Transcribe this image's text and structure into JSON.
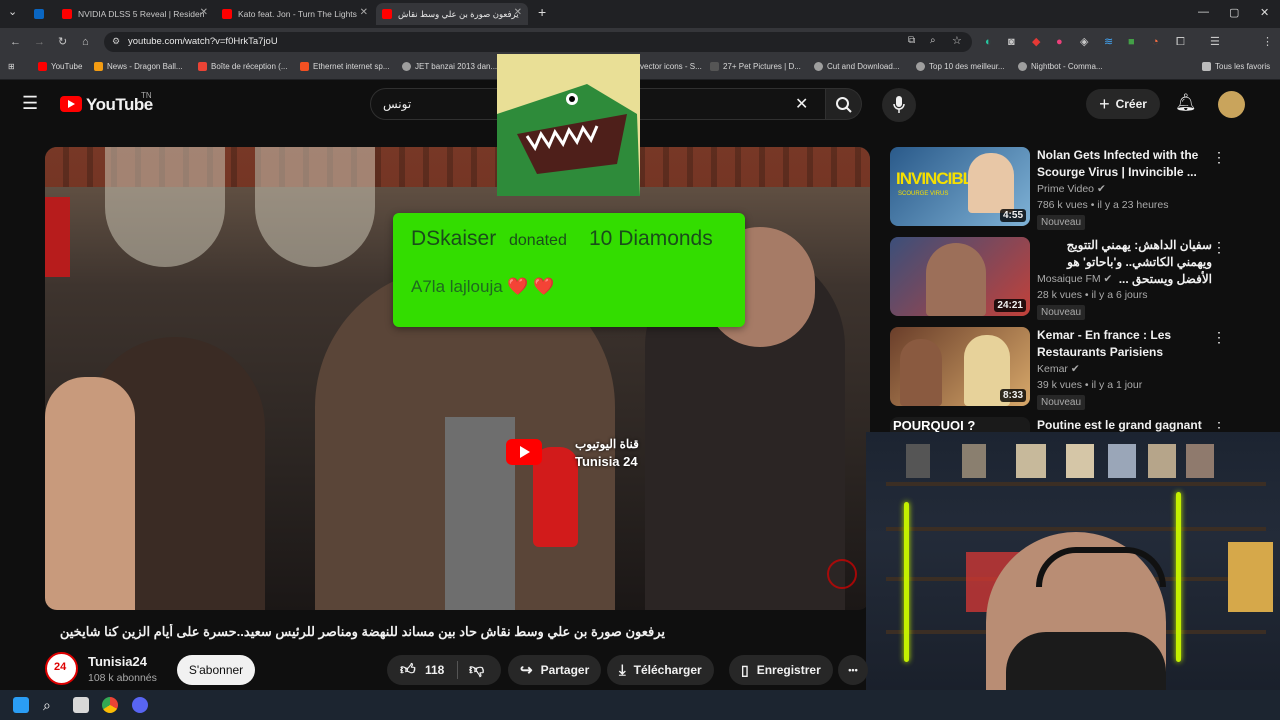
{
  "browser": {
    "tabs": [
      {
        "label": "",
        "icon": "linkedin-icon"
      },
      {
        "label": "NVIDIA DLSS 5 Reveal | Residen",
        "icon": "youtube-icon"
      },
      {
        "label": "Kato feat. Jon - Turn The Lights",
        "icon": "youtube-icon"
      },
      {
        "label": "يرفعون صورة بن علي وسط نقاش",
        "icon": "youtube-icon"
      }
    ],
    "new_tab": "+",
    "window_controls": [
      "—",
      "▢",
      "✕"
    ],
    "url": "youtube.com/watch?v=f0HrkTa7joU"
  },
  "bookmarks": [
    "YouTube",
    "News - Dragon Ball...",
    "Boîte de réception (...",
    "Ethernet internet sp...",
    "JET banzai 2013 dan...",
    "vector icons - S...",
    "27+ Pet Pictures | D...",
    "Cut and Download...",
    "Top 10 des meilleur...",
    "Nightbot - Comma..."
  ],
  "bookmarks_all": "Tous les favoris",
  "youtube": {
    "logo_text": "YouTube",
    "logo_region": "TN",
    "search_value": "تونس",
    "create_label": "Créer"
  },
  "overlay": {
    "donor": "DSkaiser",
    "donated_text": "donated",
    "amount": "10 Diamonds",
    "message": "A7la lajlouja ❤️ ❤️"
  },
  "watermark": {
    "arabic": "قناة اليوتيوب",
    "channel": "Tunisia 24"
  },
  "video": {
    "title": "يرفعون صورة بن علي وسط نقاش حاد بين مساند للنهضة ومناصر للرئيس سعيد..حسرة على أيام الزين كنا شايخين",
    "channel_name": "Tunisia24",
    "subscribers": "108 k abonnés",
    "subscribe_label": "S'abonner",
    "likes": "118",
    "share_label": "Partager",
    "download_label": "Télécharger",
    "save_label": "Enregistrer",
    "more_label": "•••"
  },
  "recommendations": [
    {
      "title": "Nolan Gets Infected with the Scourge Virus | Invincible ...",
      "channel": "Prime Video",
      "meta": "786 k vues • il y a 23 heures",
      "badge": "Nouveau",
      "duration": "4:55",
      "thumb_text": "INVINCIBLE",
      "thumb_sub": "SCOURGE VIRUS"
    },
    {
      "title": "سفيان الداهش: يهمني التتويج ويهمني الكاتشي.. و'باحاتو' هو الأفضل ويستحق ...",
      "channel": "Mosaique FM",
      "meta": "28 k vues • il y a 6 jours",
      "badge": "Nouveau",
      "duration": "24:21",
      "thumb_text": "",
      "thumb_sub": ""
    },
    {
      "title": "Kemar - En france : Les Restaurants Parisiens",
      "channel": "Kemar",
      "meta": "39 k vues • il y a 1 jour",
      "badge": "Nouveau",
      "duration": "8:33",
      "thumb_text": "",
      "thumb_sub": ""
    },
    {
      "title": "Poutine est le grand gagnant de",
      "channel": "",
      "meta": "",
      "badge": "",
      "duration": "",
      "thumb_text": "POURQUOI ?",
      "thumb_sub": ""
    }
  ],
  "colors": {
    "youtube_red": "#ff0000",
    "donation_green": "#33dd00",
    "page_bg": "#0f0f0f",
    "neon": "#c4f000"
  }
}
